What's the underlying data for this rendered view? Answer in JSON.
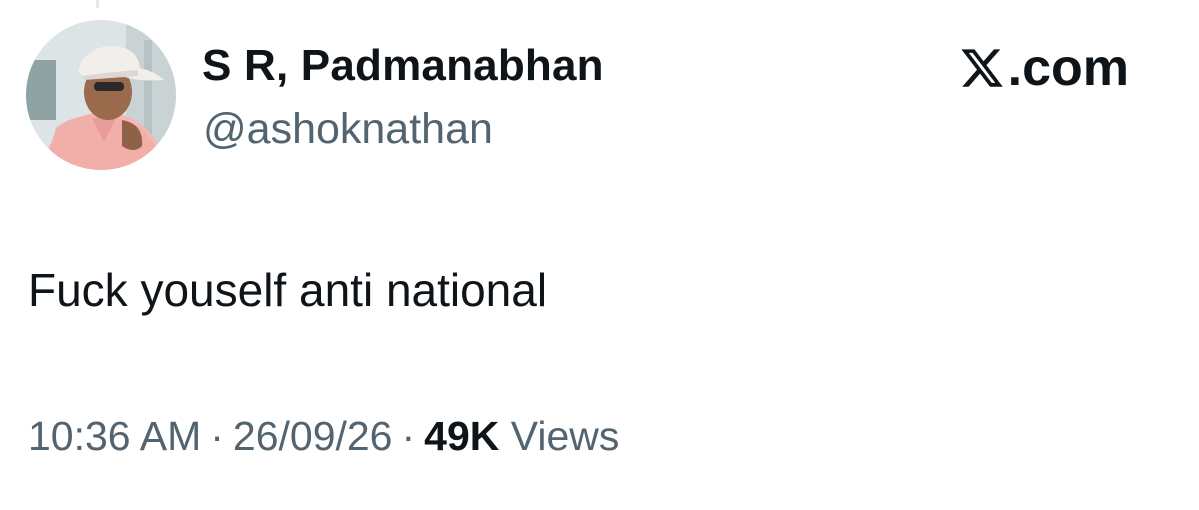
{
  "user": {
    "display_name": "S R, Padmanabhan",
    "handle": "@ashoknathan"
  },
  "brand": {
    "logo_icon": "x-logo-icon",
    "domain_suffix": ".com"
  },
  "tweet": {
    "text": "Fuck youself anti national"
  },
  "meta": {
    "time": "10:36 AM",
    "separator": "·",
    "date": "26/09/26",
    "views_count": "49K",
    "views_label": "Views"
  },
  "colors": {
    "primary_text": "#0f1419",
    "secondary_text": "#536471",
    "background": "#ffffff"
  }
}
